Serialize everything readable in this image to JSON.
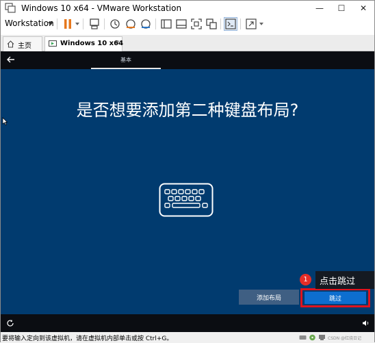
{
  "window": {
    "title": "Windows 10 x64 - VMware Workstation",
    "minimize_glyph": "—",
    "maximize_glyph": "☐",
    "close_glyph": "✕"
  },
  "toolbar": {
    "workstation_menu": "Workstation",
    "icons": [
      "pause-icon",
      "send-ctrl-alt-del-icon",
      "snapshot-icon",
      "revert-snapshot-icon",
      "snapshot-manager-icon",
      "library-view-icon",
      "thumbnail-view-icon",
      "fullscreen-exit-icon",
      "unity-icon",
      "console-view-icon",
      "stretch-icon"
    ]
  },
  "tabs": [
    {
      "label": "主页",
      "icon": "home-icon",
      "active": false
    },
    {
      "label": "Windows 10 x64",
      "icon": "vm-icon",
      "active": true,
      "close_glyph": "✕"
    }
  ],
  "vm": {
    "step_label": "基本",
    "title": "是否想要添加第二种键盘布局?",
    "add_layout_button": "添加布局",
    "skip_button": "跳过",
    "callout": {
      "number": "1",
      "text": "点击跳过"
    },
    "colors": {
      "background": "#013b6f",
      "skip": "#0d6ecf",
      "add": "#3f5f83",
      "highlight": "#e0141e"
    }
  },
  "statusbar": {
    "text": "要将输入定向到该虚拟机，请在虚拟机内部单击或按 Ctrl+G。",
    "watermark": "CSDN @红烧日记"
  }
}
